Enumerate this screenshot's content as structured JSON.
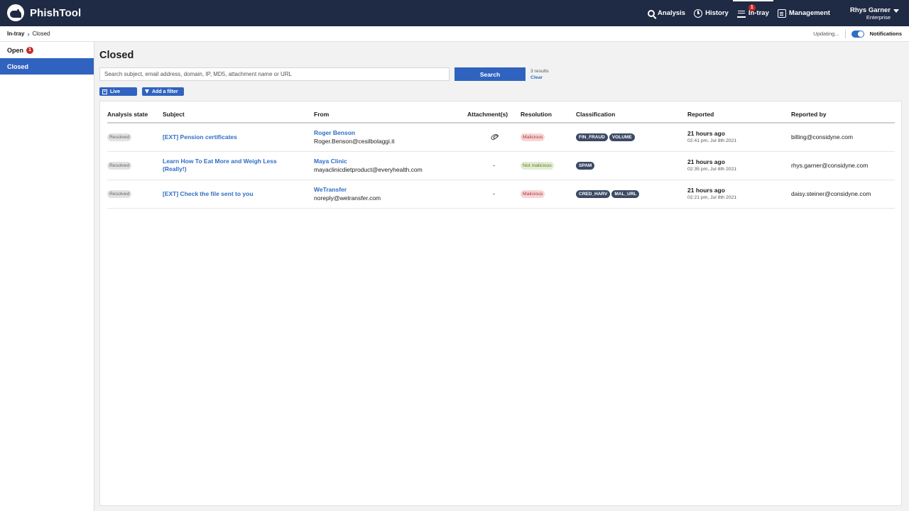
{
  "app": {
    "name": "PhishTool"
  },
  "nav": {
    "items": [
      {
        "label": "Analysis",
        "icon": "search-icon"
      },
      {
        "label": "History",
        "icon": "history-icon"
      },
      {
        "label": "In-tray",
        "icon": "inbox-tray-icon",
        "badge": "1"
      },
      {
        "label": "Management",
        "icon": "management-icon"
      }
    ],
    "active": "In-tray"
  },
  "user": {
    "name": "Rhys Garner",
    "plan": "Enterprise"
  },
  "breadcrumb": {
    "root": "In-tray",
    "current": "Closed"
  },
  "status": {
    "updating": "Updating...",
    "notifications_label": "Notifications",
    "notifications_on": true
  },
  "sidebar": {
    "items": [
      {
        "label": "Open",
        "badge": "1"
      },
      {
        "label": "Closed"
      }
    ],
    "active": "Closed"
  },
  "page": {
    "title": "Closed"
  },
  "search": {
    "placeholder": "Search subject, email address, domain, IP, MD5, attachment name or URL",
    "value": "",
    "button_label": "Search",
    "results_count": "3 results",
    "clear_label": "Clear"
  },
  "filters": {
    "live_label": "Live",
    "add_filter_label": "Add a filter"
  },
  "table": {
    "headers": [
      "Analysis state",
      "Subject",
      "From",
      "Attachment(s)",
      "Resolution",
      "Classification",
      "Reported",
      "Reported by"
    ],
    "rows": [
      {
        "state": "Resolved",
        "subject": "[EXT] Pension certificates",
        "from_name": "Roger Benson",
        "from_email": "Roger.Benson@cesilbolaggi.it",
        "attachment": "paperclip",
        "resolution": "Malicious",
        "resolution_kind": "malicious",
        "tags": [
          "FIN_FRAUD",
          "VOLUME"
        ],
        "reported_ago": "21 hours ago",
        "reported_time": "02:41 pm, Jul 8th 2021",
        "reported_by": "billing@considyne.com"
      },
      {
        "state": "Resolved",
        "subject": "Learn How To Eat More and Weigh Less (Really!)",
        "from_name": "Maya Clinic",
        "from_email": "mayaclinicdietproduct@everyhealth.com",
        "attachment": "-",
        "resolution": "Not malicious",
        "resolution_kind": "ok",
        "tags": [
          "SPAM"
        ],
        "reported_ago": "21 hours ago",
        "reported_time": "02:35 pm, Jul 8th 2021",
        "reported_by": "rhys.garner@considyne.com"
      },
      {
        "state": "Resolved",
        "subject": "[EXT] Check the file sent to you",
        "from_name": "WeTransfer",
        "from_email": "noreply@wetransfer.com",
        "attachment": "-",
        "resolution": "Malicious",
        "resolution_kind": "malicious",
        "tags": [
          "CRED_HARV",
          "MAL_URL"
        ],
        "reported_ago": "21 hours ago",
        "reported_time": "02:21 pm, Jul 8th 2021",
        "reported_by": "daisy.steiner@considyne.com"
      }
    ]
  },
  "colors": {
    "topbar": "#1f2a44",
    "accent": "#3063bf",
    "badge": "#c62828",
    "link": "#2f6ec5"
  }
}
